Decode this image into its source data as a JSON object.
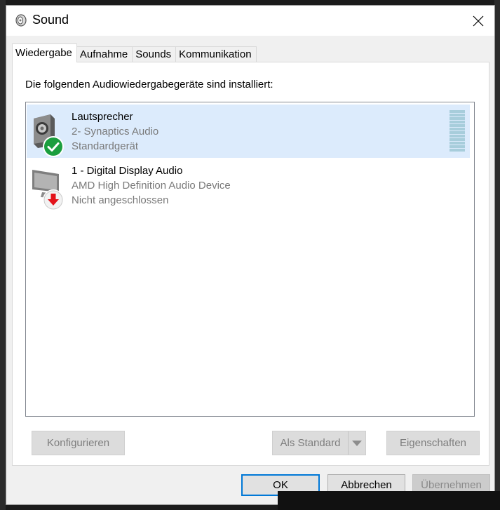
{
  "window": {
    "title": "Sound",
    "icon": "speaker-icon"
  },
  "tabs": [
    {
      "label": "Wiedergabe",
      "active": true
    },
    {
      "label": "Aufnahme",
      "active": false
    },
    {
      "label": "Sounds",
      "active": false
    },
    {
      "label": "Kommunikation",
      "active": false
    }
  ],
  "playback": {
    "instruction": "Die folgenden Audiowiedergabegeräte sind installiert:",
    "devices": [
      {
        "name": "Lautsprecher",
        "driver": "2- Synaptics Audio",
        "status": "Standardgerät",
        "selected": true,
        "icon": "speaker-icon",
        "badge": "check-badge-icon"
      },
      {
        "name": "1 - Digital Display Audio",
        "driver": "AMD High Definition Audio Device",
        "status": "Nicht angeschlossen",
        "selected": false,
        "icon": "monitor-icon",
        "badge": "down-arrow-badge-icon"
      }
    ],
    "buttons": {
      "configure": "Konfigurieren",
      "set_default": "Als Standard",
      "properties": "Eigenschaften"
    }
  },
  "footer": {
    "ok": "OK",
    "cancel": "Abbrechen",
    "apply": "Übernehmen"
  },
  "colors": {
    "selection": "#dcebfc",
    "accent": "#0078d7",
    "check_badge": "#1b9e3e",
    "arrow_badge": "#e3121a"
  }
}
